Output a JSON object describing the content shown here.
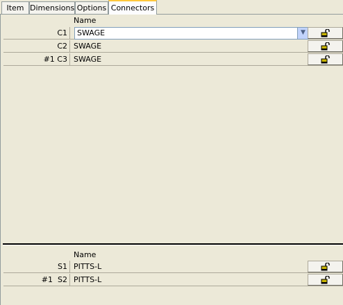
{
  "tabs": [
    {
      "label": "Item"
    },
    {
      "label": "Dimensions"
    },
    {
      "label": "Options"
    },
    {
      "label": "Connectors"
    }
  ],
  "connectors": {
    "column_header": "Name",
    "rows": [
      {
        "label": "C1",
        "value": "SWAGE"
      },
      {
        "label": "C2",
        "value": "SWAGE"
      },
      {
        "label": "#1 C3",
        "value": "SWAGE"
      }
    ]
  },
  "segments": {
    "column_header": "Name",
    "rows": [
      {
        "label": "S1",
        "value": "PITTS-L"
      },
      {
        "label": "#1  S2",
        "value": "PITTS-L"
      }
    ]
  },
  "icons": {
    "lock": "unlocked-padlock-icon",
    "dropdown": "chevron-down-icon"
  },
  "colors": {
    "active_tab_accent": "#ffc83c",
    "panel_background": "#ece9d8",
    "lock_body": "#c8b400"
  }
}
